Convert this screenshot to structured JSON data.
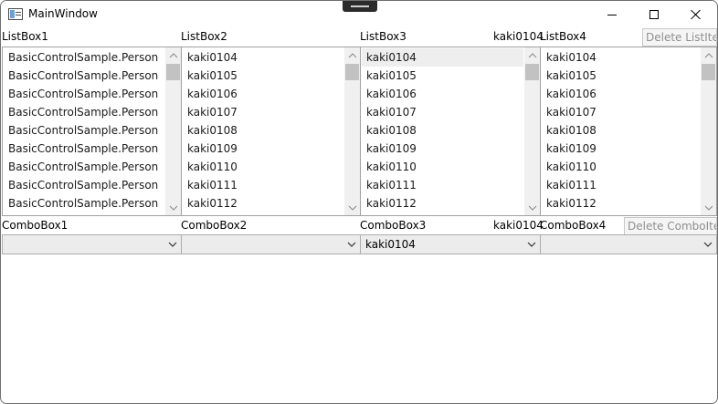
{
  "window": {
    "title": "MainWindow"
  },
  "labels": {
    "listbox1": "ListBox1",
    "listbox2": "ListBox2",
    "listbox3": "ListBox3",
    "listbox4": "ListBox4",
    "combobox1": "ComboBox1",
    "combobox2": "ComboBox2",
    "combobox3": "ComboBox3",
    "combobox4": "ComboBox4"
  },
  "listbox3_selected_display": "kaki0104",
  "combobox3_selected_display": "kaki0104",
  "buttons": {
    "delete_list_item": "Delete ListItem",
    "delete_combo_item": "Delete ComboItem"
  },
  "listbox1": {
    "items": [
      "BasicControlSample.Person",
      "BasicControlSample.Person",
      "BasicControlSample.Person",
      "BasicControlSample.Person",
      "BasicControlSample.Person",
      "BasicControlSample.Person",
      "BasicControlSample.Person",
      "BasicControlSample.Person",
      "BasicControlSample.Person"
    ]
  },
  "listbox2": {
    "items": [
      "kaki0104",
      "kaki0105",
      "kaki0106",
      "kaki0107",
      "kaki0108",
      "kaki0109",
      "kaki0110",
      "kaki0111",
      "kaki0112"
    ]
  },
  "listbox3": {
    "items": [
      "kaki0104",
      "kaki0105",
      "kaki0106",
      "kaki0107",
      "kaki0108",
      "kaki0109",
      "kaki0110",
      "kaki0111",
      "kaki0112"
    ],
    "selected_index": 0
  },
  "listbox4": {
    "items": [
      "kaki0104",
      "kaki0105",
      "kaki0106",
      "kaki0107",
      "kaki0108",
      "kaki0109",
      "kaki0110",
      "kaki0111",
      "kaki0112"
    ]
  },
  "combobox1": {
    "value": ""
  },
  "combobox2": {
    "value": ""
  },
  "combobox3": {
    "value": "kaki0104"
  },
  "combobox4": {
    "value": ""
  },
  "icons": {
    "app": "window-icon",
    "minimize": "minimize-icon",
    "maximize": "maximize-icon",
    "close": "close-icon",
    "scroll_up": "chevron-up-icon",
    "scroll_down": "chevron-down-icon",
    "combo_dropdown": "chevron-down-icon"
  },
  "colors": {
    "selection": "#eeeeee",
    "scroll_thumb": "#c2c2c2",
    "combo_background": "#ececec",
    "disabled_text": "#8f8f8f"
  }
}
